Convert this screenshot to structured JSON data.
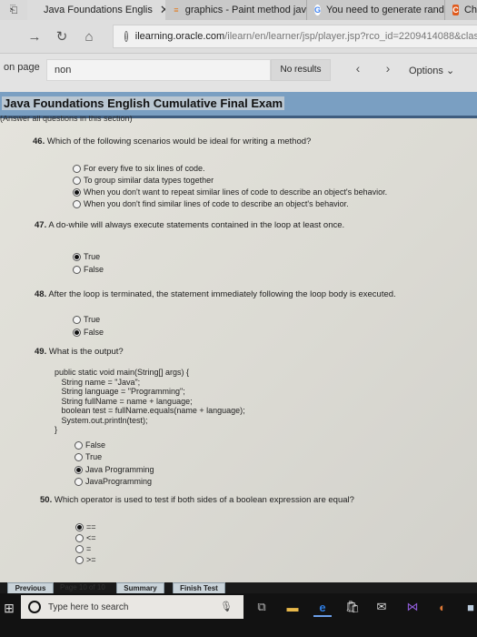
{
  "browser": {
    "tabs": [
      {
        "label": "Java Foundations Englis",
        "active": true,
        "icon": "none"
      },
      {
        "label": "graphics - Paint method jav",
        "active": false,
        "icon": "stackoverflow-icon"
      },
      {
        "label": "You need to generate randc",
        "active": false,
        "icon": "google-icon"
      },
      {
        "label": "Ch",
        "active": false,
        "icon": "c-icon"
      }
    ],
    "tab_close": "✕",
    "nav": {
      "forward": "→",
      "refresh": "↻",
      "home": "⌂"
    },
    "url": {
      "host": "ilearning.oracle.com",
      "path": "/ilearn/en/learner/jsp/player.jsp?rco_id=2209414088&classroom"
    }
  },
  "findbar": {
    "label": "on page",
    "query": "non",
    "results": "No results",
    "prev": "‹",
    "next": "›",
    "options": "Options ⌄"
  },
  "exam": {
    "title": "Java Foundations English Cumulative Final Exam",
    "section_note": "(Answer all questions in this section)",
    "questions": [
      {
        "number": "46.",
        "text": "Which of the following scenarios would be ideal for writing a method?",
        "options": [
          {
            "label": "For every five to six lines of code.",
            "selected": false
          },
          {
            "label": "To group similar data types together",
            "selected": false
          },
          {
            "label": "When you don't want to repeat similar lines of code to describe an object's behavior.",
            "selected": true
          },
          {
            "label": "When you don't find similar lines of code to describe an object's behavior.",
            "selected": false
          }
        ]
      },
      {
        "number": "47.",
        "text": "A do-while will always execute statements contained in the loop at least once.",
        "options": [
          {
            "label": "True",
            "selected": true
          },
          {
            "label": "False",
            "selected": false
          }
        ]
      },
      {
        "number": "48.",
        "text": "After the loop is terminated, the statement immediately following the loop body is executed.",
        "options": [
          {
            "label": "True",
            "selected": false
          },
          {
            "label": "False",
            "selected": true
          }
        ]
      },
      {
        "number": "49.",
        "text": "What is the output?",
        "code": [
          "public static void main(String[] args) {",
          "   String name = \"Java\";",
          "   String language = \"Programming\";",
          "   String fullName = name + language;",
          "   boolean test = fullName.equals(name + language);",
          "   System.out.println(test);",
          "}"
        ],
        "options": [
          {
            "label": "False",
            "selected": false
          },
          {
            "label": "True",
            "selected": false
          },
          {
            "label": "Java Programming",
            "selected": true
          },
          {
            "label": "JavaProgramming",
            "selected": false
          }
        ]
      },
      {
        "number": "50.",
        "text": "Which operator is used to test if both sides of a boolean expression are equal?",
        "options": [
          {
            "label": "==",
            "selected": true
          },
          {
            "label": "<=",
            "selected": false
          },
          {
            "label": "=",
            "selected": false
          },
          {
            "label": ">=",
            "selected": false
          }
        ]
      }
    ],
    "footer": {
      "previous": "Previous",
      "page": "Page 10 of 10",
      "summary": "Summary",
      "finish": "Finish Test"
    }
  },
  "taskbar": {
    "search_placeholder": "Type here to search",
    "icons": [
      "task-view-icon",
      "file-explorer-icon",
      "edge-icon",
      "store-icon",
      "mail-icon",
      "visual-studio-icon",
      "eclipse-icon",
      "app-icon"
    ]
  }
}
